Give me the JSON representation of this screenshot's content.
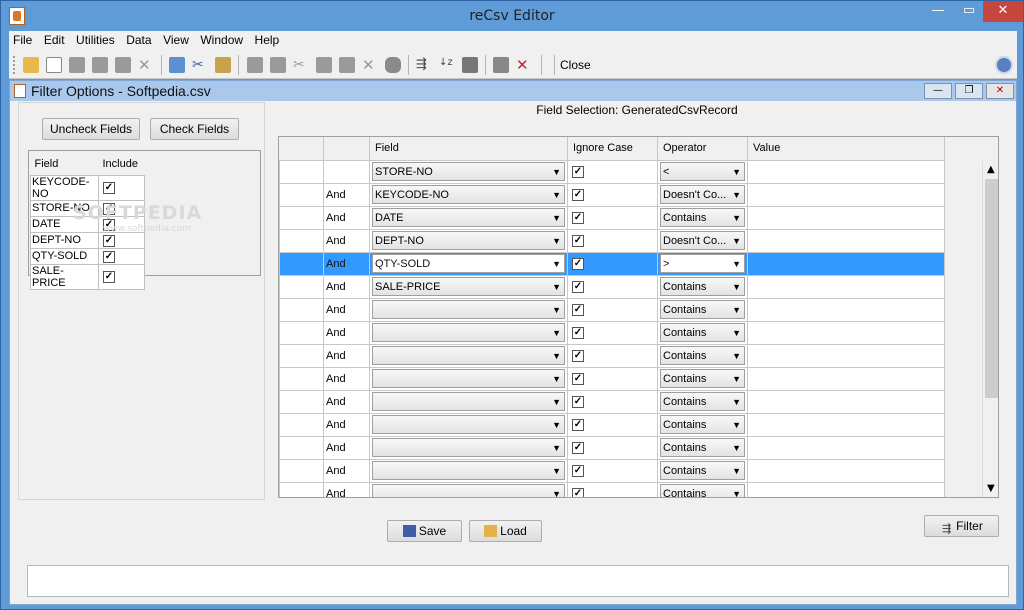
{
  "window": {
    "title": "reCsv Editor",
    "min_label": "—",
    "max_label": "▭",
    "close_label": "✕"
  },
  "menu": [
    "File",
    "Edit",
    "Utilities",
    "Data",
    "View",
    "Window",
    "Help"
  ],
  "toolbar": {
    "close_label": "Close"
  },
  "frame": {
    "title": "Filter Options - Softpedia.csv",
    "min_label": "—",
    "max_label": "❐",
    "close_label": "✕"
  },
  "left": {
    "uncheck_label": "Uncheck Fields",
    "check_label": "Check Fields",
    "headers": {
      "field": "Field",
      "include": "Include"
    },
    "fields": [
      "KEYCODE-NO",
      "STORE-NO",
      "DATE",
      "DEPT-NO",
      "QTY-SOLD",
      "SALE-PRICE"
    ],
    "watermark": "SOFTPEDIA",
    "watermark_sub": "www.softpedia.com"
  },
  "right": {
    "header": "Field Selection: GeneratedCsvRecord",
    "columns": [
      "",
      "",
      "Field",
      "Ignore Case",
      "Operator",
      "Value"
    ],
    "rows": [
      {
        "join": "",
        "field": "STORE-NO",
        "op": "<"
      },
      {
        "join": "And",
        "field": "KEYCODE-NO",
        "op": "Doesn't Co..."
      },
      {
        "join": "And",
        "field": "DATE",
        "op": "Contains"
      },
      {
        "join": "And",
        "field": "DEPT-NO",
        "op": "Doesn't Co..."
      },
      {
        "join": "And",
        "field": "QTY-SOLD",
        "op": ">"
      },
      {
        "join": "And",
        "field": "SALE-PRICE",
        "op": "Contains"
      },
      {
        "join": "And",
        "field": "",
        "op": "Contains"
      },
      {
        "join": "And",
        "field": "",
        "op": "Contains"
      },
      {
        "join": "And",
        "field": "",
        "op": "Contains"
      },
      {
        "join": "And",
        "field": "",
        "op": "Contains"
      },
      {
        "join": "And",
        "field": "",
        "op": "Contains"
      },
      {
        "join": "And",
        "field": "",
        "op": "Contains"
      },
      {
        "join": "And",
        "field": "",
        "op": "Contains"
      },
      {
        "join": "And",
        "field": "",
        "op": "Contains"
      },
      {
        "join": "And",
        "field": "",
        "op": "Contains"
      }
    ],
    "selected_row": 4
  },
  "buttons": {
    "save": "Save",
    "load": "Load",
    "filter": "Filter"
  },
  "status": {
    "text": ""
  }
}
